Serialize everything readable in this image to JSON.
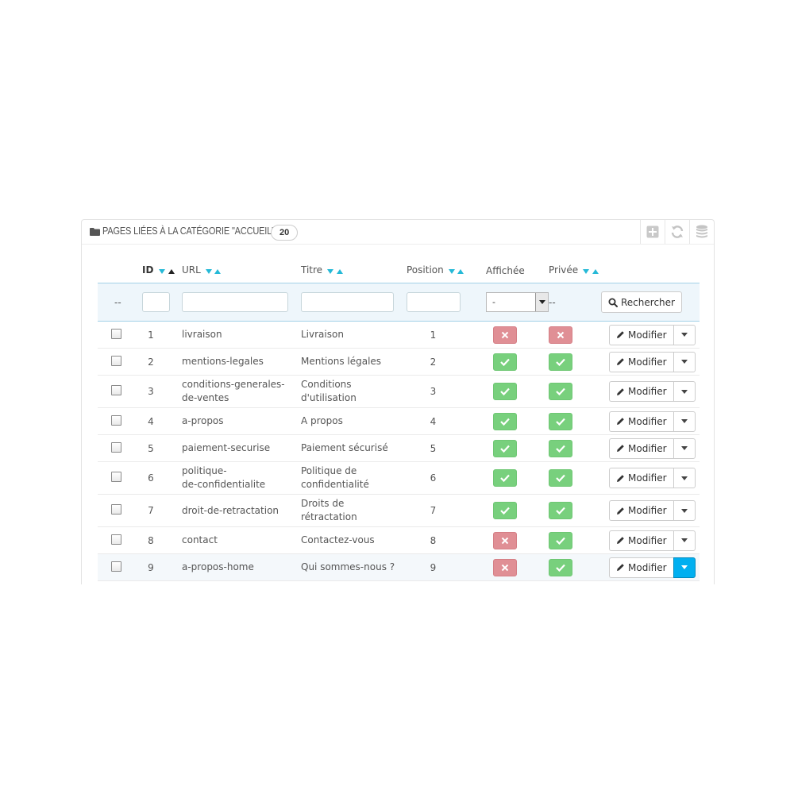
{
  "panel": {
    "title": "PAGES LIÉES À LA CATÉGORIE \"ACCUEIL\"",
    "count": "20",
    "toolbar": [
      {
        "icon": "add-icon"
      },
      {
        "icon": "refresh-icon"
      },
      {
        "icon": "database-icon"
      }
    ]
  },
  "table": {
    "headers": {
      "id": "ID",
      "url": "URL",
      "title": "Titre",
      "position": "Position",
      "displayed": "Affichée",
      "private": "Privée"
    },
    "filter": {
      "bulk_placeholder": "--",
      "displayed_value": "-",
      "private_placeholder": "--",
      "search_label": "Rechercher"
    },
    "edit_label": "Modifier",
    "rows": [
      {
        "id": "1",
        "url": "livraison",
        "title": "Livraison",
        "position": "1",
        "displayed": false,
        "private": false
      },
      {
        "id": "2",
        "url": "mentions-legales",
        "title": "Mentions légales",
        "position": "2",
        "displayed": true,
        "private": true
      },
      {
        "id": "3",
        "url": "conditions-generales-\nde-ventes",
        "title": "Conditions\nd'utilisation",
        "position": "3",
        "displayed": true,
        "private": true
      },
      {
        "id": "4",
        "url": "a-propos",
        "title": "A propos",
        "position": "4",
        "displayed": true,
        "private": true
      },
      {
        "id": "5",
        "url": "paiement-securise",
        "title": "Paiement sécurisé",
        "position": "5",
        "displayed": true,
        "private": true
      },
      {
        "id": "6",
        "url": "politique-\nde-confidentialite",
        "title": "Politique de\nconfidentialité",
        "position": "6",
        "displayed": true,
        "private": true
      },
      {
        "id": "7",
        "url": "droit-de-retractation",
        "title": "Droits de\nrétractation",
        "position": "7",
        "displayed": true,
        "private": true
      },
      {
        "id": "8",
        "url": "contact",
        "title": "Contactez-vous",
        "position": "8",
        "displayed": false,
        "private": true
      },
      {
        "id": "9",
        "url": "a-propos-home",
        "title": "Qui sommes-nous ?",
        "position": "9",
        "displayed": false,
        "private": true
      }
    ]
  },
  "colors": {
    "accent": "#25b9d7",
    "yes": "#78d07d",
    "no": "#e08f95",
    "dropdown_active": "#00aff0"
  }
}
